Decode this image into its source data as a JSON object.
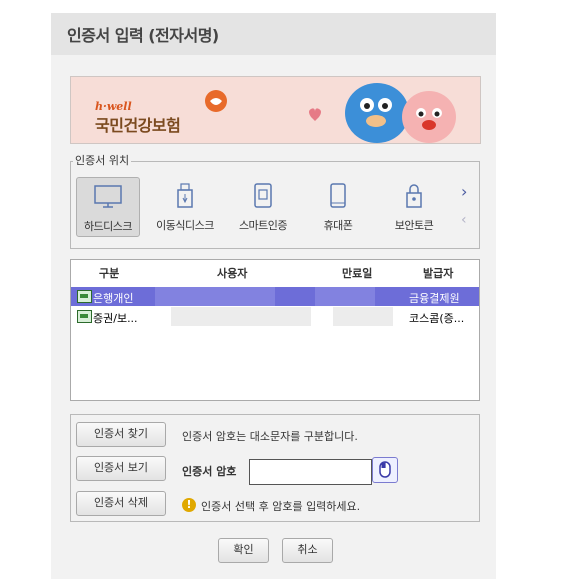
{
  "window": {
    "title": "인증서 입력 (전자서명)"
  },
  "banner": {
    "brand_small": "h·well",
    "brand_name": "국민건강보험",
    "brand_color": "#d9551e"
  },
  "location": {
    "legend": "인증서 위치",
    "items": [
      {
        "label": "하드디스크",
        "icon": "monitor-icon",
        "selected": true
      },
      {
        "label": "이동식디스크",
        "icon": "usb-drive-icon",
        "selected": false
      },
      {
        "label": "스마트인증",
        "icon": "smart-auth-icon",
        "selected": false
      },
      {
        "label": "휴대폰",
        "icon": "phone-icon",
        "selected": false
      },
      {
        "label": "보안토큰",
        "icon": "security-token-icon",
        "selected": false
      }
    ],
    "next_arrow": "›",
    "prev_arrow": "‹"
  },
  "cert_list": {
    "columns": [
      "구분",
      "사용자",
      "만료일",
      "발급자"
    ],
    "rows": [
      {
        "type": "은행개인",
        "user": "",
        "expiry": "",
        "issuer": "금융결제원",
        "selected": true
      },
      {
        "type": "증권/보...",
        "user": "",
        "expiry": "",
        "issuer": "코스콤(증...",
        "selected": false
      }
    ]
  },
  "actions": {
    "find": "인증서 찾기",
    "view": "인증서 보기",
    "delete": "인증서 삭제",
    "case_notice": "인증서 암호는 대소문자를 구분합니다.",
    "password_label": "인증서 암호",
    "password_value": "",
    "hint": "인증서 선택 후 암호를 입력하세요."
  },
  "footer": {
    "ok": "확인",
    "cancel": "취소"
  },
  "colors": {
    "selection": "#6d6dd8",
    "dialog_bg": "#f2f2f2"
  }
}
